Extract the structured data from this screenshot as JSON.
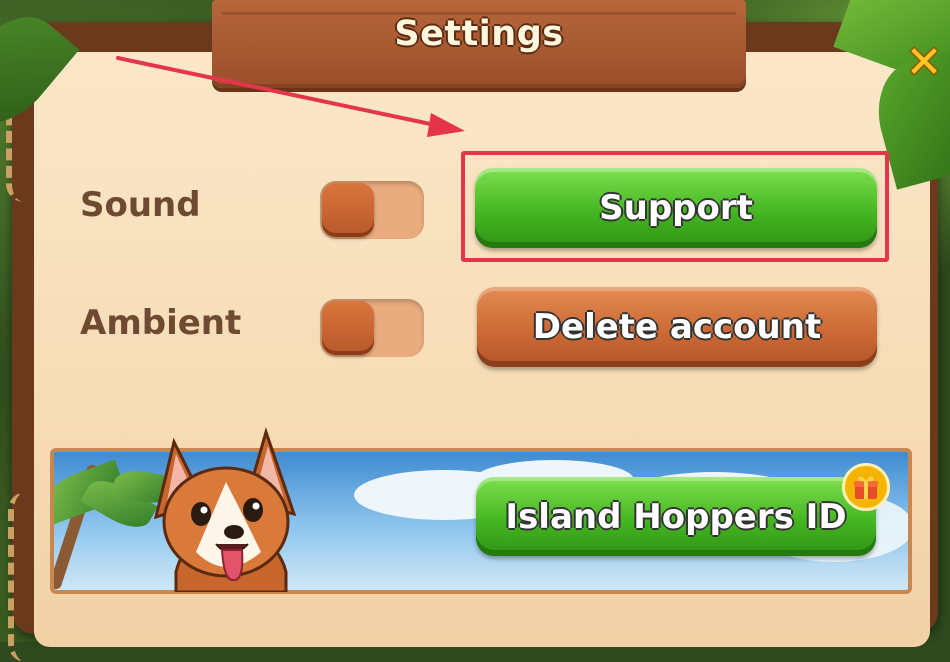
{
  "dialog": {
    "title": "Settings",
    "close_icon": "close-x-icon"
  },
  "settings": [
    {
      "label": "Sound",
      "toggle_on": false
    },
    {
      "label": "Ambient",
      "toggle_on": false
    }
  ],
  "buttons": {
    "support": "Support",
    "delete_account": "Delete account",
    "island_id": "Island Hoppers ID"
  },
  "banner": {
    "mascot": "corgi-dog-mascot",
    "badge_icon": "gift-icon"
  },
  "annotation": {
    "highlight_color": "#e4354b",
    "arrow_color": "#e4354b"
  },
  "colors": {
    "green_button": "#45b622",
    "orange_button": "#cd6a35",
    "panel_bg": "#f6dcb6",
    "wood_frame": "#6b3a1c",
    "label_text": "#6e4a33"
  }
}
